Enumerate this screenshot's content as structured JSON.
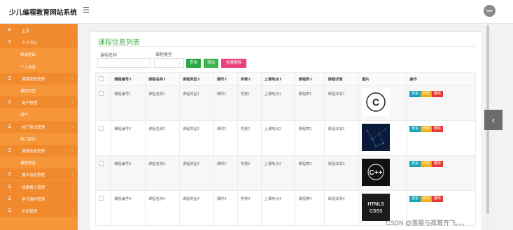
{
  "app": {
    "title": "少儿编程教育网站系统",
    "menu_icon": "☰",
    "avatar_icon": "user-avatar"
  },
  "sidebar": {
    "items": [
      {
        "label": "主页",
        "type": "group",
        "icon": "flag-icon",
        "glyph": "⚑"
      },
      {
        "label": "个人中心",
        "type": "group",
        "icon": "menu-icon",
        "glyph": "☰",
        "chevron": "⌄"
      },
      {
        "label": "修改密码",
        "type": "sub"
      },
      {
        "label": "个人信息",
        "type": "sub"
      },
      {
        "label": "课程类型管理",
        "type": "group",
        "icon": "menu-icon",
        "glyph": "☰",
        "chevron": "⌄"
      },
      {
        "label": "课程类型",
        "type": "sub"
      },
      {
        "label": "用户管理",
        "type": "group",
        "icon": "menu-icon",
        "glyph": "☰",
        "chevron": "⌄"
      },
      {
        "label": "用户",
        "type": "sub"
      },
      {
        "label": "热门资讯管理",
        "type": "group",
        "icon": "menu-icon",
        "glyph": "☰",
        "chevron": "⌄"
      },
      {
        "label": "热门资讯",
        "type": "sub"
      },
      {
        "label": "课程信息管理",
        "type": "group",
        "icon": "menu-icon",
        "glyph": "☰",
        "chevron": "⌄"
      },
      {
        "label": "课程信息",
        "type": "sub"
      },
      {
        "label": "报名信息管理",
        "type": "group",
        "icon": "menu-icon",
        "glyph": "☰",
        "chevron": "⌄"
      },
      {
        "label": "成果展示管理",
        "type": "group",
        "icon": "menu-icon",
        "glyph": "☰",
        "chevron": "⌄"
      },
      {
        "label": "学习资料管理",
        "type": "group",
        "icon": "menu-icon",
        "glyph": "☰",
        "chevron": "⌄"
      },
      {
        "label": "论坛管理",
        "type": "group",
        "icon": "menu-icon",
        "glyph": "☰",
        "chevron": "⌄"
      }
    ]
  },
  "page": {
    "title": "课程信息列表"
  },
  "filters": {
    "name_label": "课程名称",
    "type_label": "课程类型",
    "name_value": "",
    "type_value": "",
    "select_arrow": "⌄"
  },
  "buttons": {
    "search": "查询",
    "add": "添加",
    "batch_delete": "批量删除"
  },
  "colors": {
    "sidebar": "#f7953a",
    "accent_green": "#4caf50",
    "search": "#28a745",
    "add": "#3bb34a",
    "batch_delete": "#ec407a",
    "view": "#17a2b8",
    "edit": "#f0ad1e",
    "delete": "#e53935"
  },
  "table": {
    "headers": [
      "",
      "课程编号⇕",
      "课程名称⇕",
      "课程类型⇕",
      "课时⇕",
      "学费⇕",
      "上课地点⇕",
      "课程表⇕",
      "课程详情",
      "图片",
      "操作"
    ],
    "rows": [
      {
        "cells": [
          "课程编号1",
          "课程名称1",
          "课程类型1",
          "课时1",
          "学费1",
          "上课地点1",
          "课程表1",
          "课程详情1"
        ],
        "image": "c-logo"
      },
      {
        "cells": [
          "课程编号2",
          "课程名称2",
          "课程类型2",
          "课时2",
          "学费2",
          "上课地点2",
          "课程表2",
          "课程详情2"
        ],
        "image": "blue-network"
      },
      {
        "cells": [
          "课程编号3",
          "课程名称3",
          "课程类型3",
          "课时3",
          "学费3",
          "上课地点3",
          "课程表3",
          "课程详情3"
        ],
        "image": "cpp-logo"
      },
      {
        "cells": [
          "课程编号4",
          "课程名称4",
          "课程类型4",
          "课时4",
          "学费4",
          "上课地点4",
          "课程表4",
          "课程详情4"
        ],
        "image": "html5-css3",
        "image_text": "HTML5\nCSS3"
      }
    ],
    "actions": {
      "view": "查看",
      "edit": "修改",
      "delete": "删除"
    }
  },
  "side_toggle": "‹",
  "watermark": "CSDN @落霞与孤鹜齐飞。。。"
}
